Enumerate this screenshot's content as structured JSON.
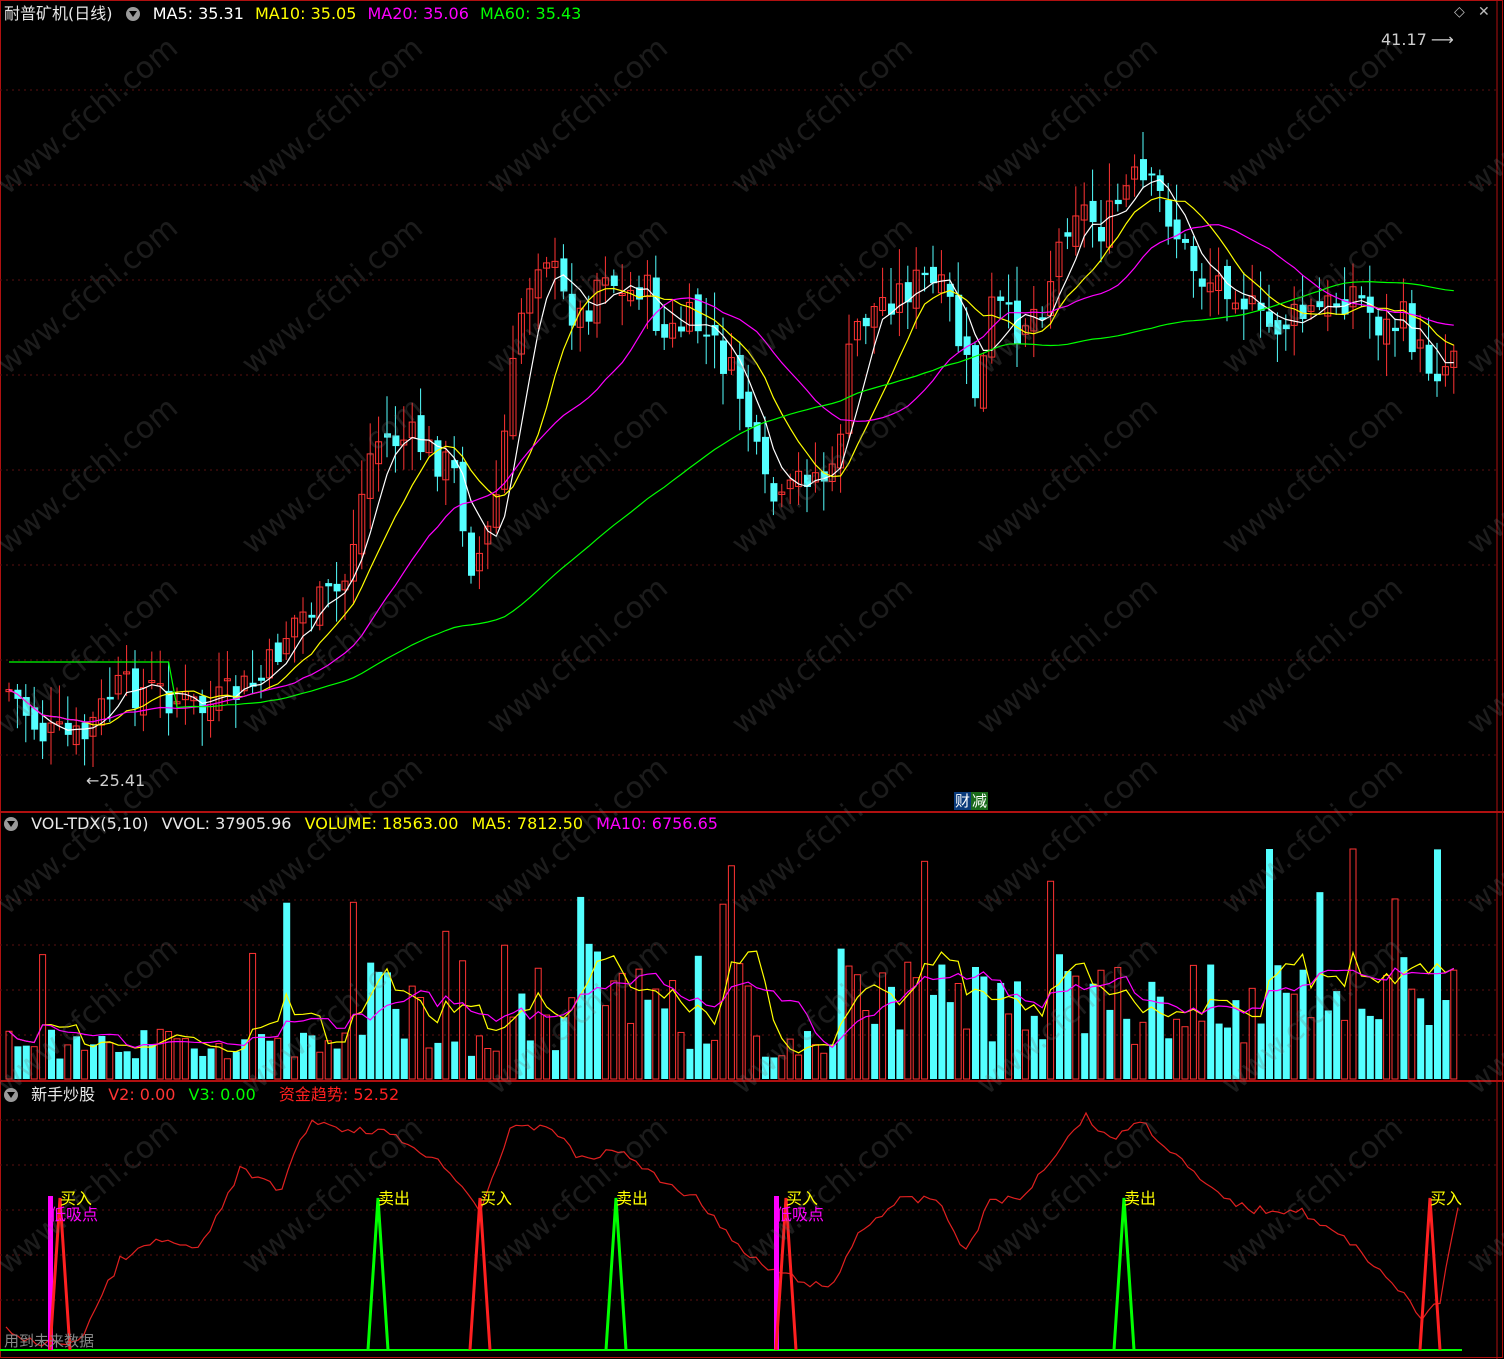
{
  "main_panel": {
    "stock_name": "耐普矿机(日线)",
    "ma5": "MA5: 35.31",
    "ma10": "MA10: 35.05",
    "ma20": "MA20: 35.06",
    "ma60": "MA60: 35.43",
    "high_label": "41.17",
    "low_label": "25.41",
    "badge": "财",
    "badge2": "减",
    "colors": {
      "ma5": "#ffffff",
      "ma10": "#ffff00",
      "ma20": "#ff00ff",
      "ma60": "#00ff00",
      "up": "#ff3333",
      "down": "#54ffff"
    }
  },
  "volume_panel": {
    "name": "VOL-TDX(5,10)",
    "vvol": "VVOL: 37905.96",
    "volume": "VOLUME: 18563.00",
    "ma5": "MA5: 7812.50",
    "ma10": "MA10: 6756.65"
  },
  "indicator_panel": {
    "name": "新手炒股",
    "v2": "V2: 0.00",
    "v3": "V3: 0.00",
    "trend": "资金趋势: 52.52",
    "footer_text": "用到未来数据",
    "signals": [
      {
        "label": "买入",
        "sub": "低吸点"
      },
      {
        "label": "卖出"
      },
      {
        "label": "买入"
      },
      {
        "label": "卖出"
      },
      {
        "label": "买入",
        "sub": "低吸点"
      },
      {
        "label": "卖出"
      },
      {
        "label": "买入"
      }
    ]
  },
  "watermark": "www.cfchi.com",
  "toolbar": {
    "diamond_icon": "diamond-icon",
    "close_icon": "close-icon"
  }
}
